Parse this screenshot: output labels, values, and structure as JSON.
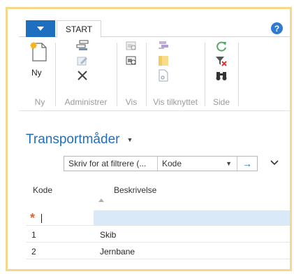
{
  "ribbon": {
    "tab_start": "START",
    "help": "?",
    "groups": {
      "ny": {
        "label": "Ny",
        "new_label": "Ny"
      },
      "administrer": {
        "label": "Administrer"
      },
      "vis": {
        "label": "Vis"
      },
      "vis_tilknyttet": {
        "label": "Vis tilknyttet"
      },
      "side": {
        "label": "Side"
      }
    }
  },
  "page": {
    "title": "Transportmåder"
  },
  "filter": {
    "placeholder": "Skriv for at filtrere (...",
    "field": "Kode"
  },
  "table": {
    "columns": [
      "Kode",
      "Beskrivelse"
    ],
    "rows": [
      {
        "kode": "1",
        "beskrivelse": "Skib"
      },
      {
        "kode": "2",
        "beskrivelse": "Jernbane"
      }
    ]
  },
  "colors": {
    "accent": "#1f6fc0",
    "new_row": "#d9e9f8",
    "star": "#e8602b"
  }
}
